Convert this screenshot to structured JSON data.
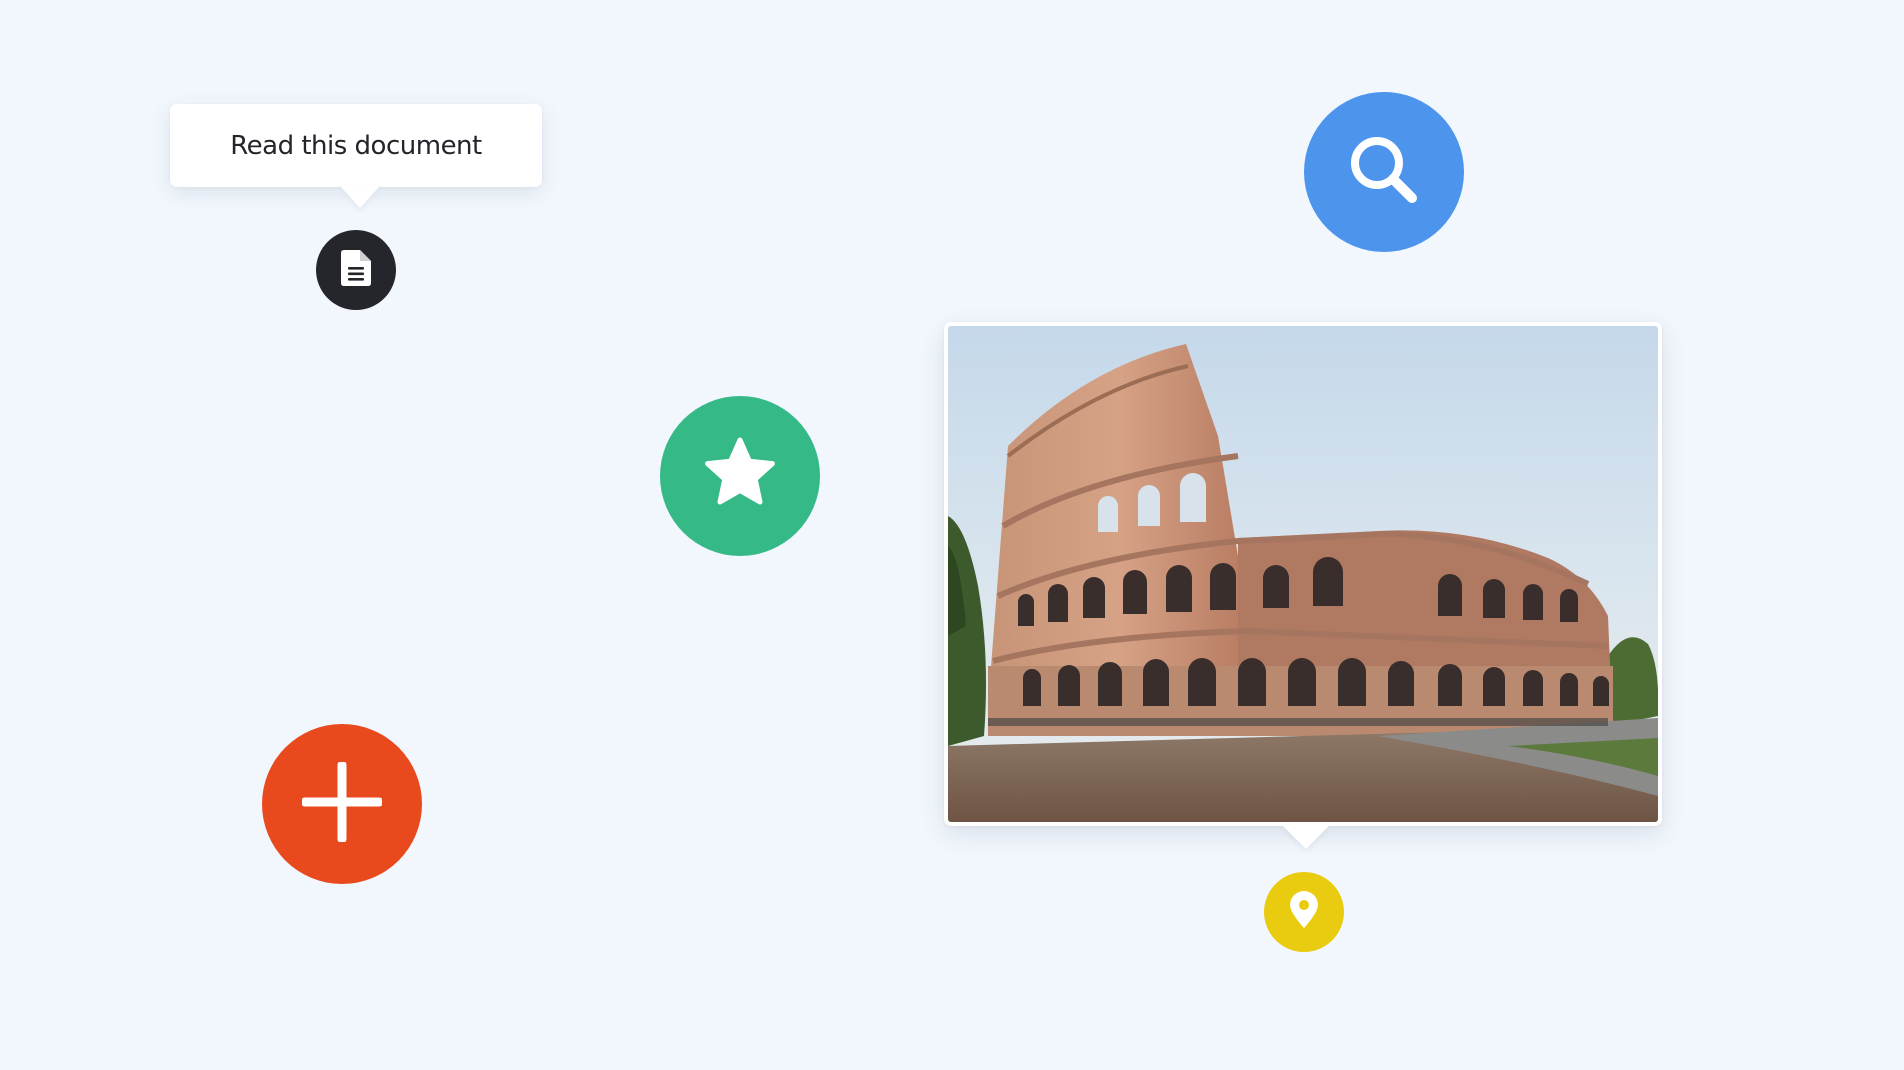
{
  "tooltip": {
    "text": "Read this document"
  },
  "buttons": {
    "document": {
      "icon": "document-icon",
      "color": "#25262b"
    },
    "search": {
      "icon": "search-icon",
      "color": "#4d94ec"
    },
    "favorite": {
      "icon": "star-icon",
      "color": "#35ba87"
    },
    "add": {
      "icon": "plus-icon",
      "color": "#e84a1d"
    },
    "location": {
      "icon": "location-pin-icon",
      "color": "#e9cb10"
    }
  },
  "photo": {
    "subject": "colosseum-photo"
  },
  "background_color": "#f2f7fd"
}
